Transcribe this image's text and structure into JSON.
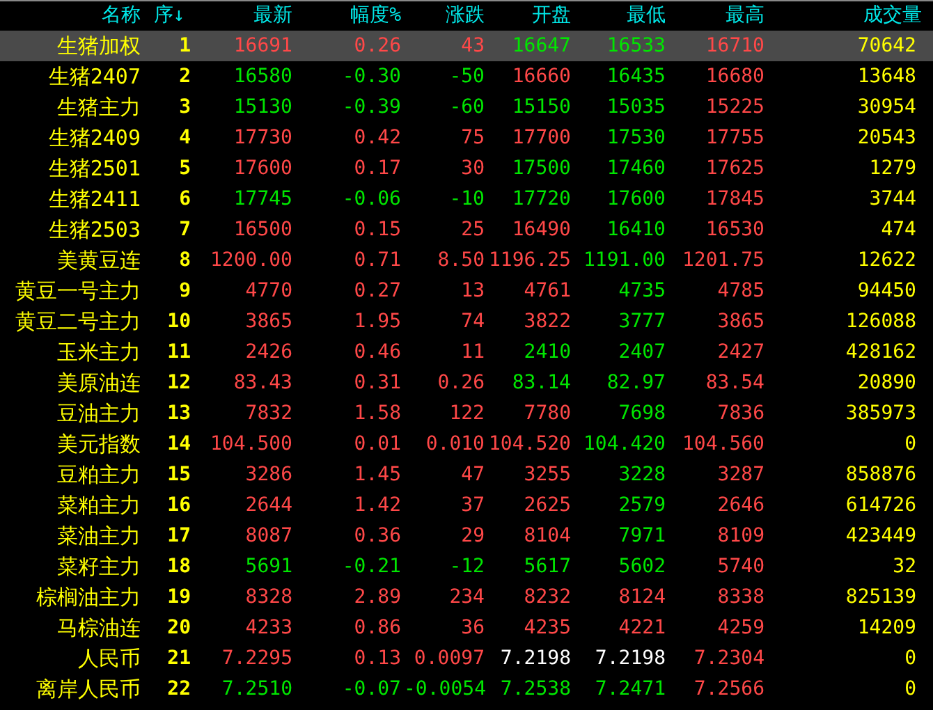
{
  "columns": [
    "名称",
    "序↓",
    "最新",
    "幅度%",
    "涨跌",
    "开盘",
    "最低",
    "最高",
    "成交量"
  ],
  "rows": [
    {
      "name": "生猪加权",
      "seq": "1",
      "selected": true,
      "cells": [
        {
          "text": "16691",
          "color": "#ff4848"
        },
        {
          "text": "0.26",
          "color": "#ff4848"
        },
        {
          "text": "43",
          "color": "#ff4848"
        },
        {
          "text": "16647",
          "color": "#00e600"
        },
        {
          "text": "16533",
          "color": "#00e600"
        },
        {
          "text": "16710",
          "color": "#ff4848"
        }
      ],
      "volume": "70642"
    },
    {
      "name": "生猪2407",
      "seq": "2",
      "selected": false,
      "cells": [
        {
          "text": "16580",
          "color": "#00e600"
        },
        {
          "text": "-0.30",
          "color": "#00e600"
        },
        {
          "text": "-50",
          "color": "#00e600"
        },
        {
          "text": "16660",
          "color": "#ff4848"
        },
        {
          "text": "16435",
          "color": "#00e600"
        },
        {
          "text": "16680",
          "color": "#ff4848"
        }
      ],
      "volume": "13648"
    },
    {
      "name": "生猪主力",
      "seq": "3",
      "selected": false,
      "cells": [
        {
          "text": "15130",
          "color": "#00e600"
        },
        {
          "text": "-0.39",
          "color": "#00e600"
        },
        {
          "text": "-60",
          "color": "#00e600"
        },
        {
          "text": "15150",
          "color": "#00e600"
        },
        {
          "text": "15035",
          "color": "#00e600"
        },
        {
          "text": "15225",
          "color": "#ff4848"
        }
      ],
      "volume": "30954"
    },
    {
      "name": "生猪2409",
      "seq": "4",
      "selected": false,
      "cells": [
        {
          "text": "17730",
          "color": "#ff4848"
        },
        {
          "text": "0.42",
          "color": "#ff4848"
        },
        {
          "text": "75",
          "color": "#ff4848"
        },
        {
          "text": "17700",
          "color": "#ff4848"
        },
        {
          "text": "17530",
          "color": "#00e600"
        },
        {
          "text": "17755",
          "color": "#ff4848"
        }
      ],
      "volume": "20543"
    },
    {
      "name": "生猪2501",
      "seq": "5",
      "selected": false,
      "cells": [
        {
          "text": "17600",
          "color": "#ff4848"
        },
        {
          "text": "0.17",
          "color": "#ff4848"
        },
        {
          "text": "30",
          "color": "#ff4848"
        },
        {
          "text": "17500",
          "color": "#00e600"
        },
        {
          "text": "17460",
          "color": "#00e600"
        },
        {
          "text": "17625",
          "color": "#ff4848"
        }
      ],
      "volume": "1279"
    },
    {
      "name": "生猪2411",
      "seq": "6",
      "selected": false,
      "cells": [
        {
          "text": "17745",
          "color": "#00e600"
        },
        {
          "text": "-0.06",
          "color": "#00e600"
        },
        {
          "text": "-10",
          "color": "#00e600"
        },
        {
          "text": "17720",
          "color": "#00e600"
        },
        {
          "text": "17600",
          "color": "#00e600"
        },
        {
          "text": "17845",
          "color": "#ff4848"
        }
      ],
      "volume": "3744"
    },
    {
      "name": "生猪2503",
      "seq": "7",
      "selected": false,
      "cells": [
        {
          "text": "16500",
          "color": "#ff4848"
        },
        {
          "text": "0.15",
          "color": "#ff4848"
        },
        {
          "text": "25",
          "color": "#ff4848"
        },
        {
          "text": "16490",
          "color": "#ff4848"
        },
        {
          "text": "16410",
          "color": "#00e600"
        },
        {
          "text": "16530",
          "color": "#ff4848"
        }
      ],
      "volume": "474"
    },
    {
      "name": "美黄豆连",
      "seq": "8",
      "selected": false,
      "cells": [
        {
          "text": "1200.00",
          "color": "#ff4848"
        },
        {
          "text": "0.71",
          "color": "#ff4848"
        },
        {
          "text": "8.50",
          "color": "#ff4848"
        },
        {
          "text": "1196.25",
          "color": "#ff4848"
        },
        {
          "text": "1191.00",
          "color": "#00e600"
        },
        {
          "text": "1201.75",
          "color": "#ff4848"
        }
      ],
      "volume": "12622"
    },
    {
      "name": "黄豆一号主力",
      "seq": "9",
      "selected": false,
      "cells": [
        {
          "text": "4770",
          "color": "#ff4848"
        },
        {
          "text": "0.27",
          "color": "#ff4848"
        },
        {
          "text": "13",
          "color": "#ff4848"
        },
        {
          "text": "4761",
          "color": "#ff4848"
        },
        {
          "text": "4735",
          "color": "#00e600"
        },
        {
          "text": "4785",
          "color": "#ff4848"
        }
      ],
      "volume": "94450"
    },
    {
      "name": "黄豆二号主力",
      "seq": "10",
      "selected": false,
      "cells": [
        {
          "text": "3865",
          "color": "#ff4848"
        },
        {
          "text": "1.95",
          "color": "#ff4848"
        },
        {
          "text": "74",
          "color": "#ff4848"
        },
        {
          "text": "3822",
          "color": "#ff4848"
        },
        {
          "text": "3777",
          "color": "#00e600"
        },
        {
          "text": "3865",
          "color": "#ff4848"
        }
      ],
      "volume": "126088"
    },
    {
      "name": "玉米主力",
      "seq": "11",
      "selected": false,
      "cells": [
        {
          "text": "2426",
          "color": "#ff4848"
        },
        {
          "text": "0.46",
          "color": "#ff4848"
        },
        {
          "text": "11",
          "color": "#ff4848"
        },
        {
          "text": "2410",
          "color": "#00e600"
        },
        {
          "text": "2407",
          "color": "#00e600"
        },
        {
          "text": "2427",
          "color": "#ff4848"
        }
      ],
      "volume": "428162"
    },
    {
      "name": "美原油连",
      "seq": "12",
      "selected": false,
      "cells": [
        {
          "text": "83.43",
          "color": "#ff4848"
        },
        {
          "text": "0.31",
          "color": "#ff4848"
        },
        {
          "text": "0.26",
          "color": "#ff4848"
        },
        {
          "text": "83.14",
          "color": "#00e600"
        },
        {
          "text": "82.97",
          "color": "#00e600"
        },
        {
          "text": "83.54",
          "color": "#ff4848"
        }
      ],
      "volume": "20890"
    },
    {
      "name": "豆油主力",
      "seq": "13",
      "selected": false,
      "cells": [
        {
          "text": "7832",
          "color": "#ff4848"
        },
        {
          "text": "1.58",
          "color": "#ff4848"
        },
        {
          "text": "122",
          "color": "#ff4848"
        },
        {
          "text": "7780",
          "color": "#ff4848"
        },
        {
          "text": "7698",
          "color": "#00e600"
        },
        {
          "text": "7836",
          "color": "#ff4848"
        }
      ],
      "volume": "385973"
    },
    {
      "name": "美元指数",
      "seq": "14",
      "selected": false,
      "cells": [
        {
          "text": "104.500",
          "color": "#ff4848"
        },
        {
          "text": "0.01",
          "color": "#ff4848"
        },
        {
          "text": "0.010",
          "color": "#ff4848"
        },
        {
          "text": "104.520",
          "color": "#ff4848"
        },
        {
          "text": "104.420",
          "color": "#00e600"
        },
        {
          "text": "104.560",
          "color": "#ff4848"
        }
      ],
      "volume": "0"
    },
    {
      "name": "豆粕主力",
      "seq": "15",
      "selected": false,
      "cells": [
        {
          "text": "3286",
          "color": "#ff4848"
        },
        {
          "text": "1.45",
          "color": "#ff4848"
        },
        {
          "text": "47",
          "color": "#ff4848"
        },
        {
          "text": "3255",
          "color": "#ff4848"
        },
        {
          "text": "3228",
          "color": "#00e600"
        },
        {
          "text": "3287",
          "color": "#ff4848"
        }
      ],
      "volume": "858876"
    },
    {
      "name": "菜粕主力",
      "seq": "16",
      "selected": false,
      "cells": [
        {
          "text": "2644",
          "color": "#ff4848"
        },
        {
          "text": "1.42",
          "color": "#ff4848"
        },
        {
          "text": "37",
          "color": "#ff4848"
        },
        {
          "text": "2625",
          "color": "#ff4848"
        },
        {
          "text": "2579",
          "color": "#00e600"
        },
        {
          "text": "2646",
          "color": "#ff4848"
        }
      ],
      "volume": "614726"
    },
    {
      "name": "菜油主力",
      "seq": "17",
      "selected": false,
      "cells": [
        {
          "text": "8087",
          "color": "#ff4848"
        },
        {
          "text": "0.36",
          "color": "#ff4848"
        },
        {
          "text": "29",
          "color": "#ff4848"
        },
        {
          "text": "8104",
          "color": "#ff4848"
        },
        {
          "text": "7971",
          "color": "#00e600"
        },
        {
          "text": "8109",
          "color": "#ff4848"
        }
      ],
      "volume": "423449"
    },
    {
      "name": "菜籽主力",
      "seq": "18",
      "selected": false,
      "cells": [
        {
          "text": "5691",
          "color": "#00e600"
        },
        {
          "text": "-0.21",
          "color": "#00e600"
        },
        {
          "text": "-12",
          "color": "#00e600"
        },
        {
          "text": "5617",
          "color": "#00e600"
        },
        {
          "text": "5602",
          "color": "#00e600"
        },
        {
          "text": "5740",
          "color": "#ff4848"
        }
      ],
      "volume": "32"
    },
    {
      "name": "棕榈油主力",
      "seq": "19",
      "selected": false,
      "cells": [
        {
          "text": "8328",
          "color": "#ff4848"
        },
        {
          "text": "2.89",
          "color": "#ff4848"
        },
        {
          "text": "234",
          "color": "#ff4848"
        },
        {
          "text": "8232",
          "color": "#ff4848"
        },
        {
          "text": "8124",
          "color": "#ff4848"
        },
        {
          "text": "8338",
          "color": "#ff4848"
        }
      ],
      "volume": "825139"
    },
    {
      "name": "马棕油连",
      "seq": "20",
      "selected": false,
      "cells": [
        {
          "text": "4233",
          "color": "#ff4848"
        },
        {
          "text": "0.86",
          "color": "#ff4848"
        },
        {
          "text": "36",
          "color": "#ff4848"
        },
        {
          "text": "4235",
          "color": "#ff4848"
        },
        {
          "text": "4221",
          "color": "#ff4848"
        },
        {
          "text": "4259",
          "color": "#ff4848"
        }
      ],
      "volume": "14209"
    },
    {
      "name": "人民币",
      "seq": "21",
      "selected": false,
      "cells": [
        {
          "text": "7.2295",
          "color": "#ff4848"
        },
        {
          "text": "0.13",
          "color": "#ff4848"
        },
        {
          "text": "0.0097",
          "color": "#ff4848"
        },
        {
          "text": "7.2198",
          "color": "#ffffff"
        },
        {
          "text": "7.2198",
          "color": "#ffffff"
        },
        {
          "text": "7.2304",
          "color": "#ff4848"
        }
      ],
      "volume": "0"
    },
    {
      "name": "离岸人民币",
      "seq": "22",
      "selected": false,
      "cells": [
        {
          "text": "7.2510",
          "color": "#00e600"
        },
        {
          "text": "-0.07",
          "color": "#00e600"
        },
        {
          "text": "-0.0054",
          "color": "#00e600"
        },
        {
          "text": "7.2538",
          "color": "#00e600"
        },
        {
          "text": "7.2471",
          "color": "#00e600"
        },
        {
          "text": "7.2566",
          "color": "#ff4848"
        }
      ],
      "volume": "0"
    }
  ]
}
